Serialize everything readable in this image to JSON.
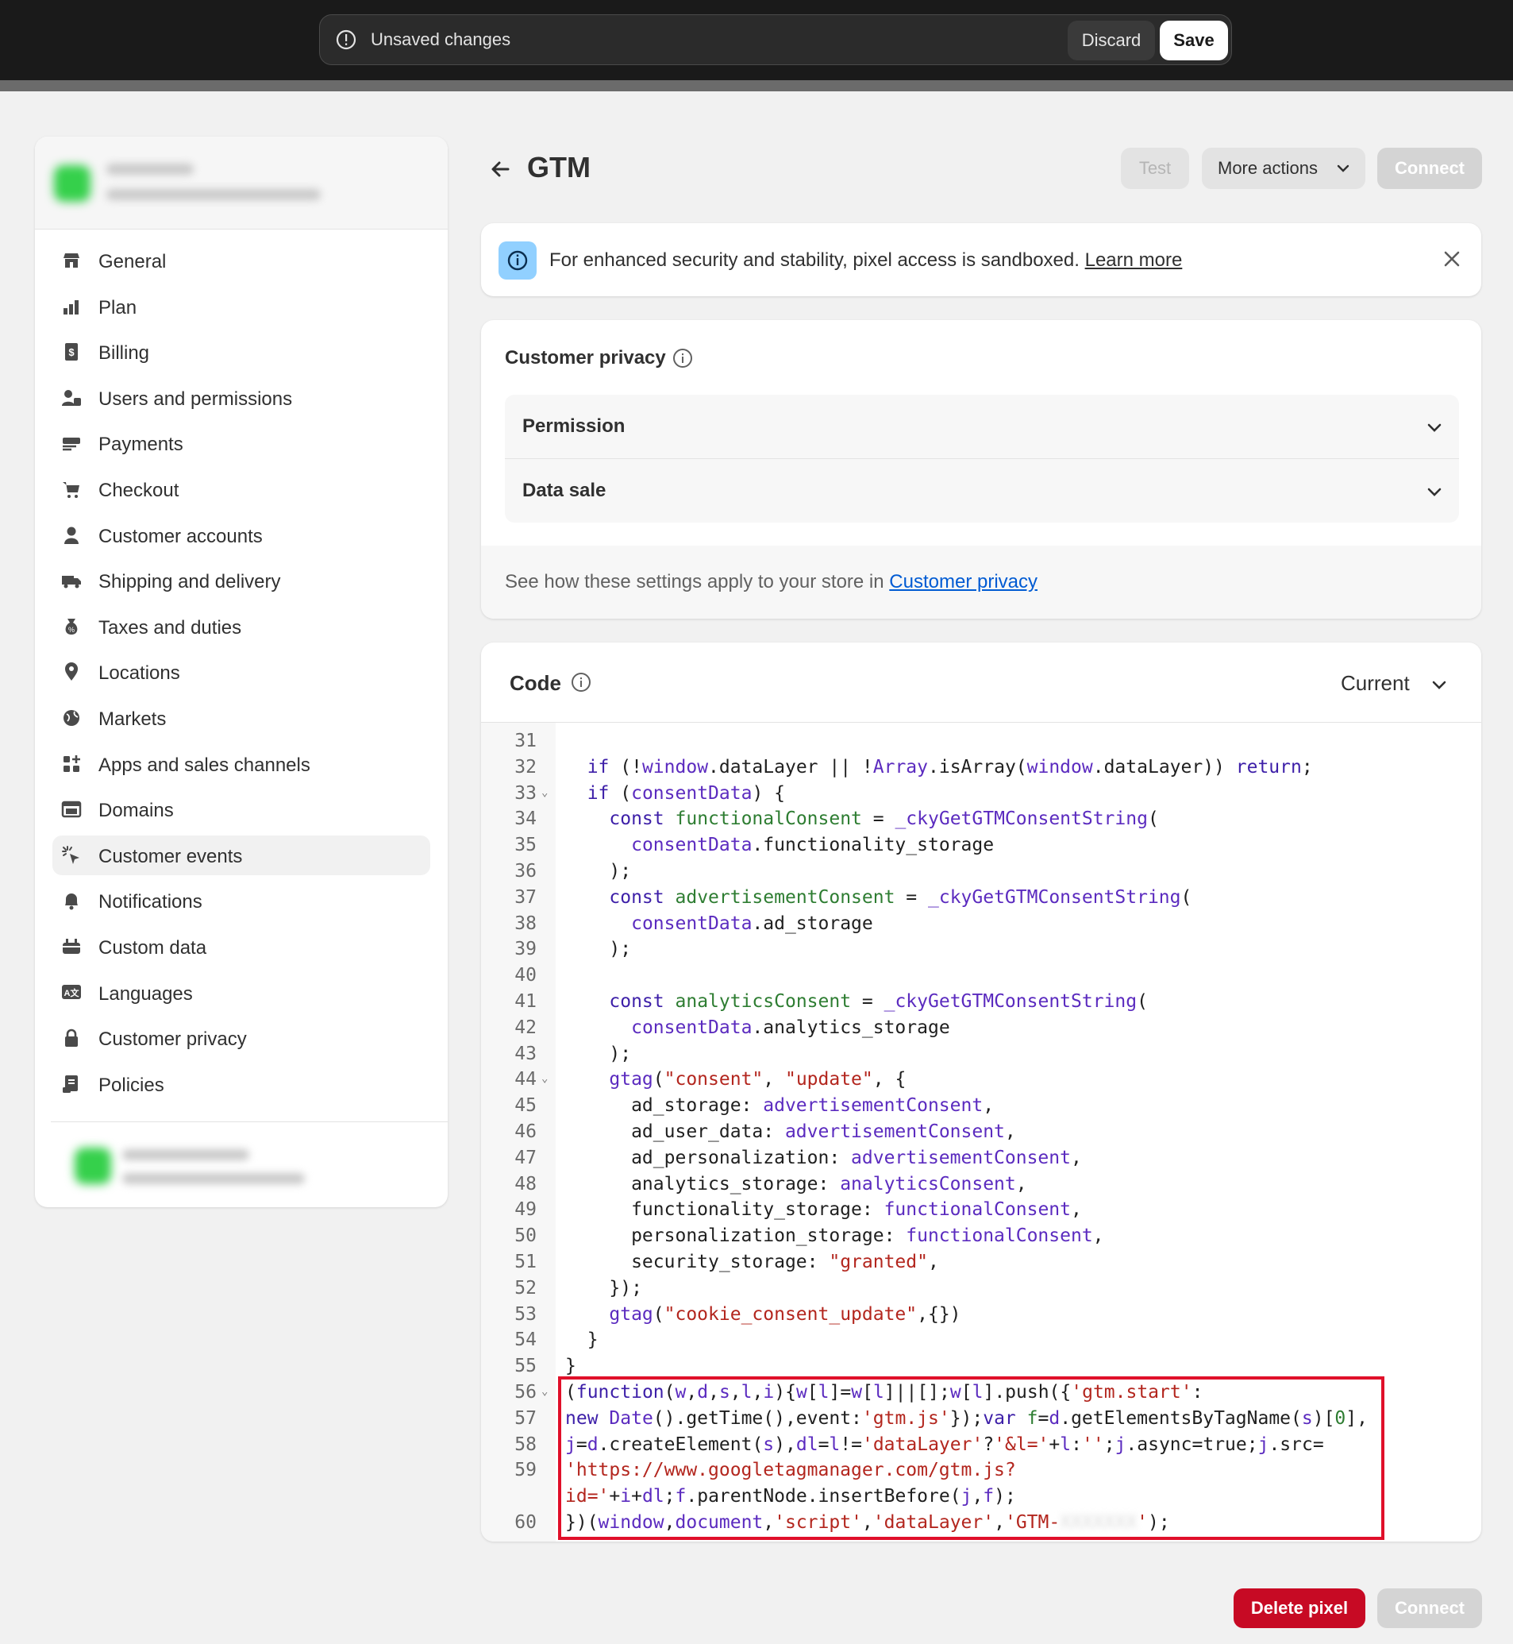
{
  "save_bar": {
    "message": "Unsaved changes",
    "discard_label": "Discard",
    "save_label": "Save"
  },
  "sidebar": {
    "items": [
      {
        "label": "General",
        "icon": "store-icon"
      },
      {
        "label": "Plan",
        "icon": "plan-icon"
      },
      {
        "label": "Billing",
        "icon": "billing-icon"
      },
      {
        "label": "Users and permissions",
        "icon": "users-icon"
      },
      {
        "label": "Payments",
        "icon": "payments-icon"
      },
      {
        "label": "Checkout",
        "icon": "cart-icon"
      },
      {
        "label": "Customer accounts",
        "icon": "person-icon"
      },
      {
        "label": "Shipping and delivery",
        "icon": "truck-icon"
      },
      {
        "label": "Taxes and duties",
        "icon": "tax-icon"
      },
      {
        "label": "Locations",
        "icon": "location-pin-icon"
      },
      {
        "label": "Markets",
        "icon": "globe-icon"
      },
      {
        "label": "Apps and sales channels",
        "icon": "apps-icon"
      },
      {
        "label": "Domains",
        "icon": "domain-icon"
      },
      {
        "label": "Customer events",
        "icon": "cursor-click-icon"
      },
      {
        "label": "Notifications",
        "icon": "bell-icon"
      },
      {
        "label": "Custom data",
        "icon": "database-icon"
      },
      {
        "label": "Languages",
        "icon": "translate-icon"
      },
      {
        "label": "Customer privacy",
        "icon": "lock-icon"
      },
      {
        "label": "Policies",
        "icon": "policy-icon"
      }
    ],
    "active_item": "Customer events"
  },
  "header": {
    "title": "GTM",
    "test_label": "Test",
    "more_actions_label": "More actions",
    "connect_label": "Connect"
  },
  "banner": {
    "text": "For enhanced security and stability, pixel access is sandboxed.",
    "link": "Learn more"
  },
  "privacy": {
    "title": "Customer privacy",
    "accordions": [
      "Permission",
      "Data sale"
    ],
    "footer_text": "See how these settings apply to your store in",
    "footer_link": "Customer privacy"
  },
  "code": {
    "title": "Code",
    "version": "Current",
    "lines": [
      {
        "n": "31",
        "fold": false,
        "html": ""
      },
      {
        "n": "32",
        "fold": false,
        "html": "  <span class=\"k\">if</span> (!<span class=\"p\">window</span>.dataLayer || !<span class=\"p\">Array</span>.isArray(<span class=\"p\">window</span>.dataLayer)) <span class=\"k\">return</span>;"
      },
      {
        "n": "33",
        "fold": true,
        "html": "  <span class=\"k\">if</span> (<span class=\"p\">consentData</span>) {"
      },
      {
        "n": "34",
        "fold": false,
        "html": "    <span class=\"k\">const</span> <span class=\"v\">functionalConsent</span> = <span class=\"p\">_ckyGetGTMConsentString</span>("
      },
      {
        "n": "35",
        "fold": false,
        "html": "      <span class=\"p\">consentData</span>.functionality_storage"
      },
      {
        "n": "36",
        "fold": false,
        "html": "    );"
      },
      {
        "n": "37",
        "fold": false,
        "html": "    <span class=\"k\">const</span> <span class=\"v\">advertisementConsent</span> = <span class=\"p\">_ckyGetGTMConsentString</span>("
      },
      {
        "n": "38",
        "fold": false,
        "html": "      <span class=\"p\">consentData</span>.ad_storage"
      },
      {
        "n": "39",
        "fold": false,
        "html": "    );"
      },
      {
        "n": "40",
        "fold": false,
        "html": ""
      },
      {
        "n": "41",
        "fold": false,
        "html": "    <span class=\"k\">const</span> <span class=\"v\">analyticsConsent</span> = <span class=\"p\">_ckyGetGTMConsentString</span>("
      },
      {
        "n": "42",
        "fold": false,
        "html": "      <span class=\"p\">consentData</span>.analytics_storage"
      },
      {
        "n": "43",
        "fold": false,
        "html": "    );"
      },
      {
        "n": "44",
        "fold": true,
        "html": "    <span class=\"p\">gtag</span>(<span class=\"s\">\"consent\"</span>, <span class=\"s\">\"update\"</span>, {"
      },
      {
        "n": "45",
        "fold": false,
        "html": "      ad_storage: <span class=\"p\">advertisementConsent</span>,"
      },
      {
        "n": "46",
        "fold": false,
        "html": "      ad_user_data: <span class=\"p\">advertisementConsent</span>,"
      },
      {
        "n": "47",
        "fold": false,
        "html": "      ad_personalization: <span class=\"p\">advertisementConsent</span>,"
      },
      {
        "n": "48",
        "fold": false,
        "html": "      analytics_storage: <span class=\"p\">analyticsConsent</span>,"
      },
      {
        "n": "49",
        "fold": false,
        "html": "      functionality_storage: <span class=\"p\">functionalConsent</span>,"
      },
      {
        "n": "50",
        "fold": false,
        "html": "      personalization_storage: <span class=\"p\">functionalConsent</span>,"
      },
      {
        "n": "51",
        "fold": false,
        "html": "      security_storage: <span class=\"s\">\"granted\"</span>,"
      },
      {
        "n": "52",
        "fold": false,
        "html": "    });"
      },
      {
        "n": "53",
        "fold": false,
        "html": "    <span class=\"p\">gtag</span>(<span class=\"s\">\"cookie_consent_update\"</span>,{})"
      },
      {
        "n": "54",
        "fold": false,
        "html": "  }"
      },
      {
        "n": "55",
        "fold": false,
        "html": "}"
      },
      {
        "n": "56",
        "fold": true,
        "html": "(<span class=\"k\">function</span>(<span class=\"p\">w</span>,<span class=\"p\">d</span>,<span class=\"p\">s</span>,<span class=\"p\">l</span>,<span class=\"p\">i</span>){<span class=\"p\">w</span>[<span class=\"p\">l</span>]=<span class=\"p\">w</span>[<span class=\"p\">l</span>]||[];<span class=\"p\">w</span>[<span class=\"p\">l</span>].push({<span class=\"s\">'gtm.start'</span>:"
      },
      {
        "n": "57",
        "fold": false,
        "html": "<span class=\"k\">new</span> <span class=\"p\">Date</span>().getTime(),event:<span class=\"s\">'gtm.js'</span>});<span class=\"k\">var</span> <span class=\"v\">f</span>=<span class=\"p\">d</span>.getElementsByTagName(<span class=\"p\">s</span>)[<span class=\"v\">0</span>],"
      },
      {
        "n": "58",
        "fold": false,
        "html": "<span class=\"p\">j</span>=<span class=\"p\">d</span>.createElement(<span class=\"p\">s</span>),<span class=\"p\">dl</span>=<span class=\"p\">l</span>!=<span class=\"s\">'dataLayer'</span>?<span class=\"s\">'&amp;l='</span>+<span class=\"p\">l</span>:<span class=\"s\">''</span>;<span class=\"p\">j</span>.async=true;<span class=\"p\">j</span>.src="
      },
      {
        "n": "59",
        "fold": false,
        "html": "<span class=\"s\">'https://www.googletagmanager.com/gtm.js?</span>"
      },
      {
        "n": "",
        "fold": false,
        "html": "<span class=\"s\">id='</span>+<span class=\"p\">i</span>+<span class=\"p\">dl</span>;<span class=\"p\">f</span>.parentNode.insertBefore(<span class=\"p\">j</span>,<span class=\"p\">f</span>);"
      },
      {
        "n": "60",
        "fold": false,
        "html": "})(<span class=\"p\">window</span>,<span class=\"p\">document</span>,<span class=\"s\">'script'</span>,<span class=\"s\">'dataLayer'</span>,<span class=\"s\">'GTM-</span><span style=\"color:#d8d8d8;filter:blur(4px)\">XXXXXXX</span><span class=\"s\">'</span>);"
      }
    ]
  },
  "footer": {
    "delete_label": "Delete pixel",
    "connect_label": "Connect"
  },
  "colors": {
    "topbar": "#1a1a1a",
    "delete": "#c70a24",
    "highlight": "#e0102a",
    "link": "#005bd3"
  }
}
